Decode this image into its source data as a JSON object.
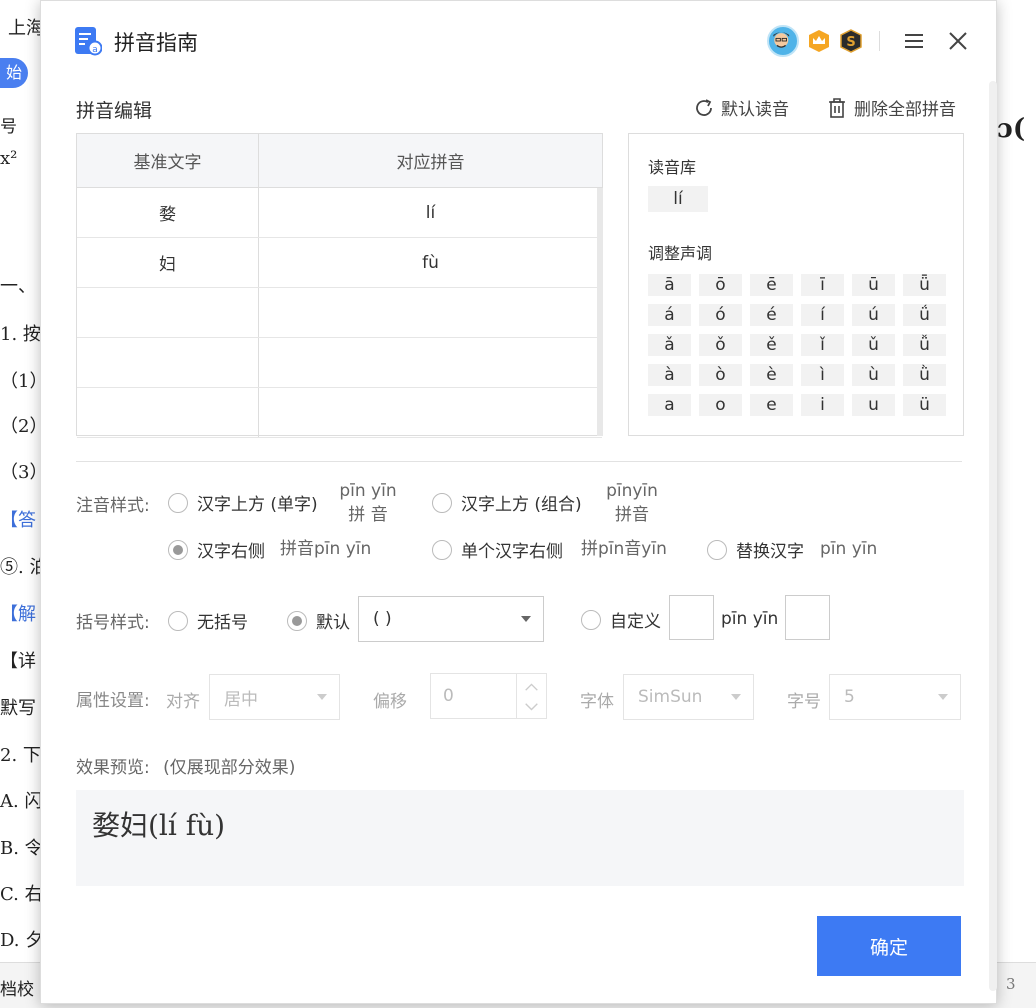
{
  "background": {
    "texts": [
      "上海",
      "号",
      "x²",
      "一、",
      "1. 按",
      "（1）",
      "（2）",
      "（3）",
      "【答",
      "⑤. 泊",
      "【解",
      "【详",
      "默写",
      "2. 下",
      "A. 闪",
      "B. 令",
      "C. 右",
      "D. 夕",
      "档校"
    ],
    "pill": "始",
    "right_glyph": "ɔ(",
    "status_right": "3"
  },
  "dialog": {
    "title": "拼音指南",
    "section_title": "拼音编辑",
    "default_reading_label": "默认读音",
    "delete_all_label": "删除全部拼音",
    "table": {
      "headers": [
        "基准文字",
        "对应拼音"
      ],
      "rows": [
        [
          "婺",
          "lí"
        ],
        [
          "妇",
          "fù"
        ],
        [
          "",
          ""
        ],
        [
          "",
          ""
        ],
        [
          "",
          ""
        ]
      ]
    },
    "reading_lib_label": "读音库",
    "reading_lib_items": [
      "lí"
    ],
    "tone_label": "调整声调",
    "tones": [
      "ā",
      "ō",
      "ē",
      "ī",
      "ū",
      "ǖ",
      "á",
      "ó",
      "é",
      "í",
      "ú",
      "ǘ",
      "ǎ",
      "ǒ",
      "ě",
      "ǐ",
      "ǔ",
      "ǚ",
      "à",
      "ò",
      "è",
      "ì",
      "ù",
      "ǜ",
      "a",
      "o",
      "e",
      "i",
      "u",
      "ü"
    ],
    "style_label": "注音样式:",
    "style_options": [
      {
        "label": "汉字上方 (单字)",
        "example_top": "pīn yīn",
        "example_bottom": "拼  音",
        "checked": false
      },
      {
        "label": "汉字上方 (组合)",
        "example_top": "pīnyīn",
        "example_bottom": "拼音",
        "checked": false
      },
      {
        "label": "汉字右侧",
        "example": "拼音pīn yīn",
        "checked": true
      },
      {
        "label": "单个汉字右侧",
        "example": "拼pīn音yīn",
        "checked": false
      },
      {
        "label": "替换汉字",
        "example": "pīn yīn",
        "checked": false
      }
    ],
    "bracket_label": "括号样式:",
    "bracket_options": {
      "none": "无括号",
      "default": "默认",
      "custom": "自定义"
    },
    "bracket_select_value": "( )",
    "custom_middle_text": "pīn yīn",
    "attr_label": "属性设置:",
    "align_label": "对齐",
    "align_value": "居中",
    "offset_label": "偏移",
    "offset_value": "0",
    "font_label": "字体",
    "font_value": "SimSun",
    "size_label": "字号",
    "size_value": "5",
    "preview_label": "效果预览:",
    "preview_note": "(仅展现部分效果)",
    "preview_text": "婺妇(lí fù)",
    "confirm_label": "确定"
  }
}
